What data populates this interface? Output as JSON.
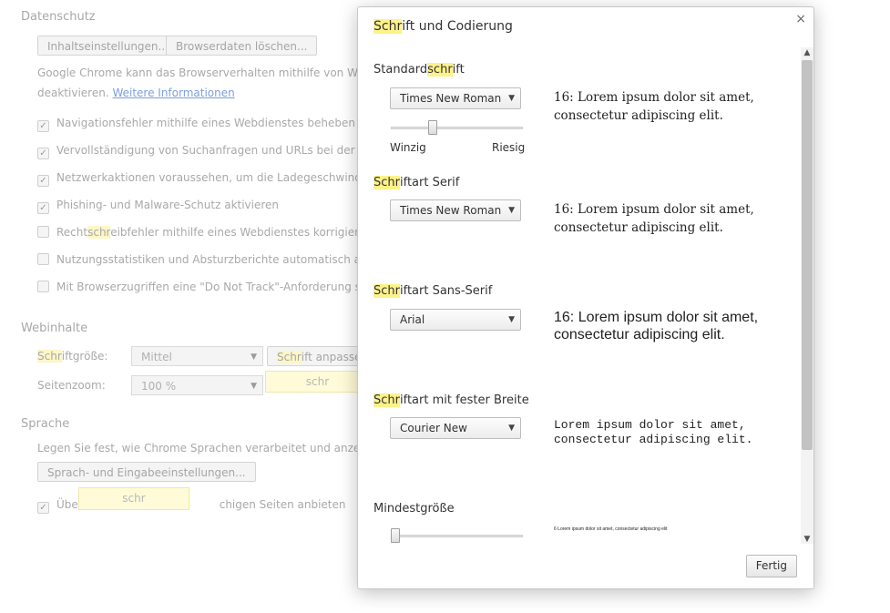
{
  "background": {
    "privacy_title": "Datenschutz",
    "content_settings_button": "Inhaltseinstellungen...",
    "clear_data_button": "Browserdaten löschen...",
    "privacy_desc_line1": "Google Chrome kann das Browserverhalten mithilfe von Webdiens",
    "privacy_desc_line2_prefix": "deaktivieren. ",
    "privacy_desc_link": "Weitere Informationen",
    "checkboxes": [
      {
        "label": "Navigationsfehler mithilfe eines Webdienstes beheben",
        "checked": true
      },
      {
        "label": "Vervollständigung von Suchanfragen und URLs bei der Eingabe",
        "checked": true
      },
      {
        "label": "Netzwerkaktionen voraussehen, um die Ladegeschwindigkeit z",
        "checked": true
      },
      {
        "label": "Phishing- und Malware-Schutz aktivieren",
        "checked": true
      },
      {
        "label_pre": "Recht",
        "label_hl": "schr",
        "label_post": "eibfehler mithilfe eines Webdienstes korrigieren",
        "checked": false
      },
      {
        "label": "Nutzungsstatistiken und Absturzberichte automatisch an Goog",
        "checked": false
      },
      {
        "label": "Mit Browserzugriffen eine \"Do Not Track\"-Anforderung sender",
        "checked": false
      }
    ],
    "web_content_title": "Webinhalte",
    "font_size_label_hl": "Schr",
    "font_size_label_rest": "iftgröße:",
    "font_size_value": "Mittel",
    "customize_fonts_hl": "Schr",
    "customize_fonts_rest": "ift anpassen...",
    "page_zoom_label": "Seitenzoom:",
    "page_zoom_value": "100 %",
    "tooltip1": "schr",
    "language_title": "Sprache",
    "language_desc": "Legen Sie fest, wie Chrome Sprachen verarbeitet und anzeigt.",
    "language_button": "Sprach- und Eingabeeinstellungen...",
    "translate_checkbox_visible": "Über",
    "translate_checkbox_tail": "chigen Seiten anbieten",
    "tooltip2": "schr"
  },
  "dialog": {
    "title_hl": "Schr",
    "title_rest": "ift und Codierung",
    "close_glyph": "×",
    "standard": {
      "label_pre": "Standard",
      "label_hl": "schr",
      "label_post": "ift",
      "font": "Times New Roman",
      "sample": "16: Lorem ipsum dolor sit amet, consectetur adipiscing elit.",
      "slider_min_label": "Winzig",
      "slider_max_label": "Riesig",
      "slider_fraction": 0.3
    },
    "serif": {
      "label_hl": "Schr",
      "label_rest": "iftart Serif",
      "font": "Times New Roman",
      "sample": "16: Lorem ipsum dolor sit amet, consectetur adipiscing elit."
    },
    "sans": {
      "label_hl": "Schr",
      "label_rest": "iftart Sans-Serif",
      "font": "Arial",
      "sample": "16: Lorem ipsum dolor sit amet, consectetur adipiscing elit."
    },
    "fixed": {
      "label_hl": "Schr",
      "label_rest": "iftart mit fester Breite",
      "font": "Courier New",
      "sample": "Lorem ipsum dolor sit amet, consectetur adipiscing elit."
    },
    "minimum": {
      "label": "Mindestgröße",
      "sample": "6 Lorem ipsum dolor sit amet, consectetur adipiscing elit",
      "slider_fraction": 0.0
    },
    "done_button": "Fertig"
  }
}
